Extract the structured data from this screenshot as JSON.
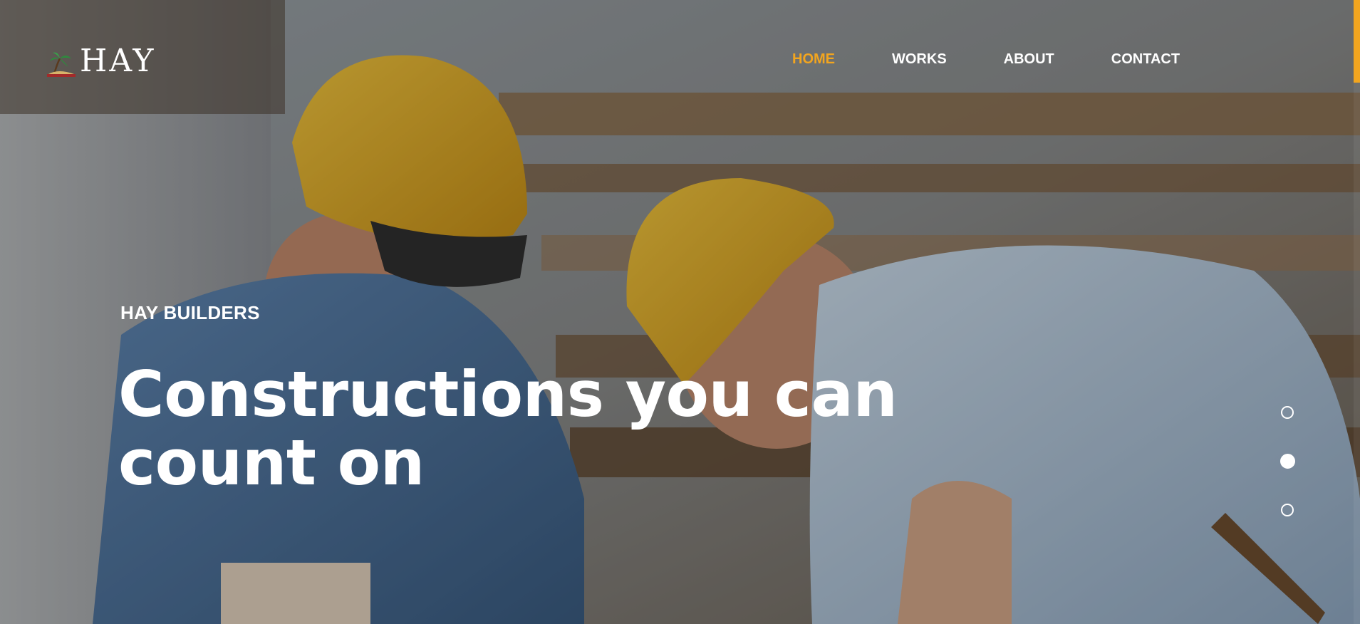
{
  "brand": {
    "name": "HAY",
    "logo_icon": "palm-tree-logo-icon"
  },
  "nav": {
    "items": [
      {
        "label": "HOME",
        "active": true
      },
      {
        "label": "WORKS",
        "active": false
      },
      {
        "label": "ABOUT",
        "active": false
      },
      {
        "label": "CONTACT",
        "active": false
      }
    ]
  },
  "hero": {
    "kicker": "HAY BUILDERS",
    "title": "Constructions you can count on"
  },
  "slider": {
    "dots": [
      {
        "active": false
      },
      {
        "active": true
      },
      {
        "active": false
      }
    ]
  },
  "colors": {
    "accent": "#f2a51f",
    "text": "#ffffff"
  }
}
